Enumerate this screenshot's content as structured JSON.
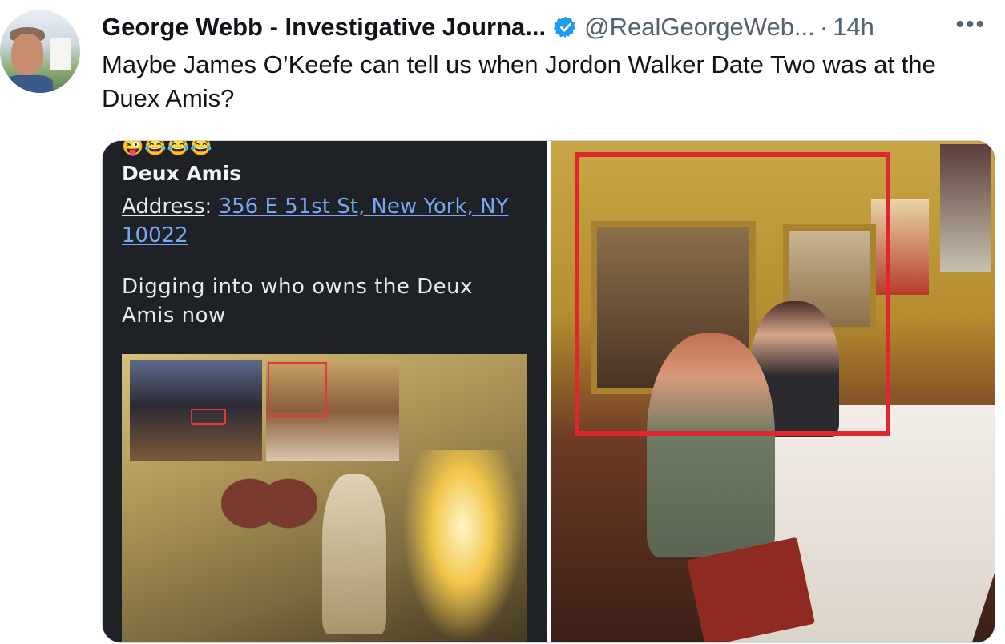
{
  "tweet": {
    "author_name": "George Webb - Investigative Journa...",
    "handle": "@RealGeorgeWeb...",
    "separator": "·",
    "time": "14h",
    "more_label": "•••",
    "text": "Maybe James O’Keefe can tell us when Jordon Walker Date Two was at the Duex Amis?"
  },
  "media": {
    "left": {
      "emojis": "😜😂😂😂",
      "place_name": "Deux Amis",
      "address_label": "Address",
      "address_sep": ": ",
      "address_value": "356 E 51st St, New York, NY 10022",
      "body": "Digging into who owns the Deux Amis now"
    }
  },
  "colors": {
    "accent": "#1d9bf0",
    "link": "#79a8f0",
    "highlight_box": "#e0262e",
    "muted_text": "#536471"
  }
}
